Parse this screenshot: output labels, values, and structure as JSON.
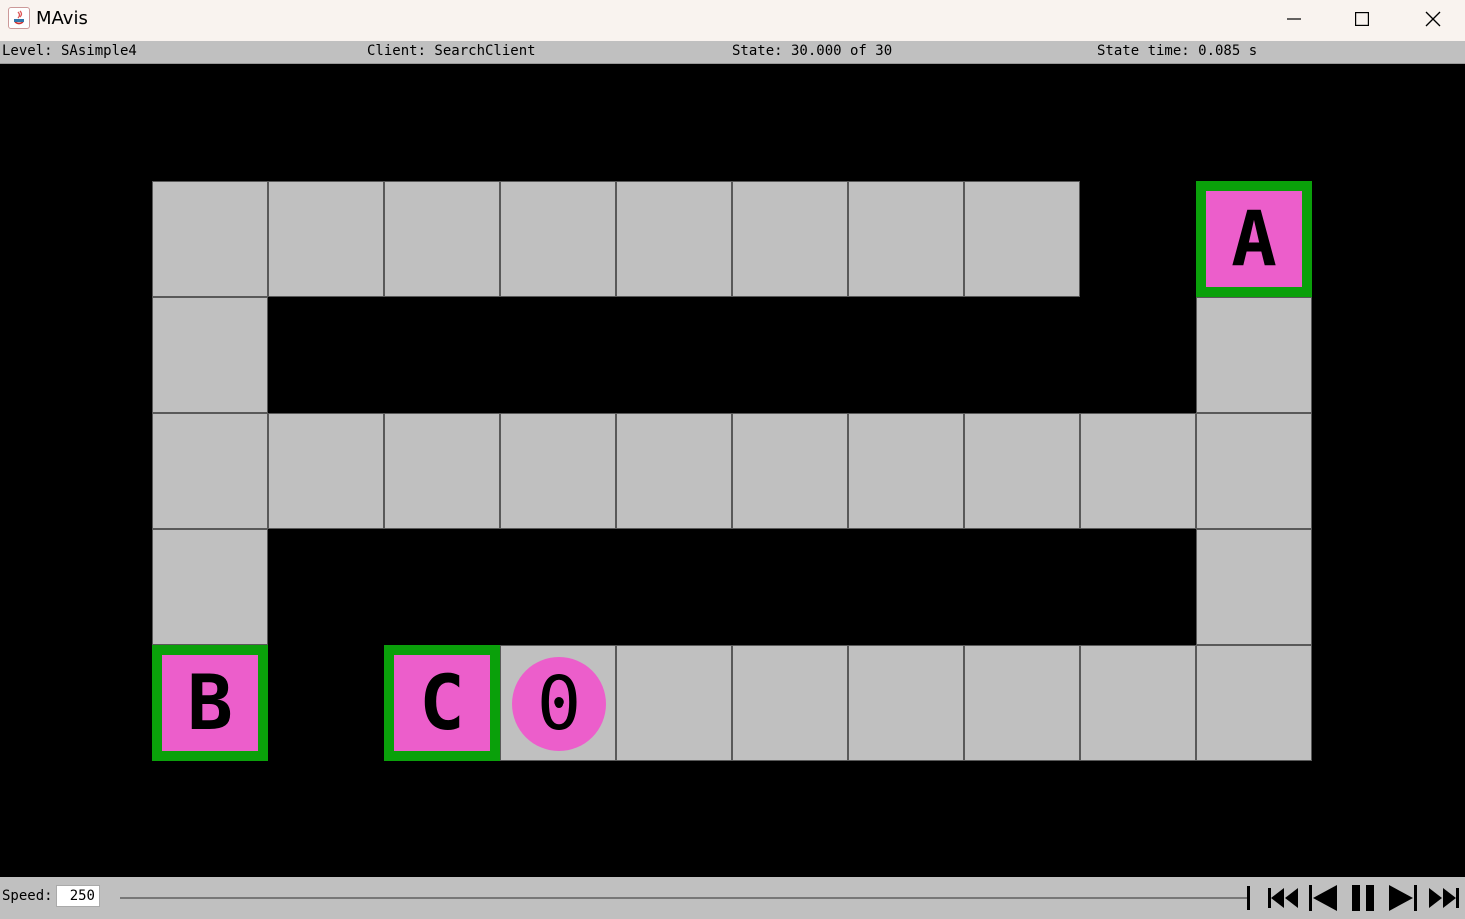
{
  "window": {
    "title": "MAvis"
  },
  "status": {
    "level": "Level: SAsimple4",
    "client": "Client: SearchClient",
    "state": "State: 30.000 of 30",
    "state_time": "State time: 0.085 s"
  },
  "colors": {
    "floor": "#c0c0c0",
    "wall": "#000000",
    "goal": "#0aa00a",
    "entity": "#ec5ecb"
  },
  "level": {
    "rows": [
      "........ A",
      ".        .",
      "..........",
      ".        .",
      "B C0......"
    ],
    "goals": [
      [
        0,
        9
      ],
      [
        4,
        0
      ],
      [
        4,
        2
      ]
    ],
    "boxes": [
      {
        "letter": "A",
        "row": 0,
        "col": 9
      },
      {
        "letter": "B",
        "row": 4,
        "col": 0
      },
      {
        "letter": "C",
        "row": 4,
        "col": 2
      }
    ],
    "agents": [
      {
        "label": "0",
        "row": 4,
        "col": 3
      }
    ]
  },
  "controls": {
    "speed_label": "Speed:",
    "speed_value": "250",
    "buttons": [
      "skip-to-start",
      "step-back",
      "pause",
      "step-forward",
      "skip-to-end"
    ]
  }
}
